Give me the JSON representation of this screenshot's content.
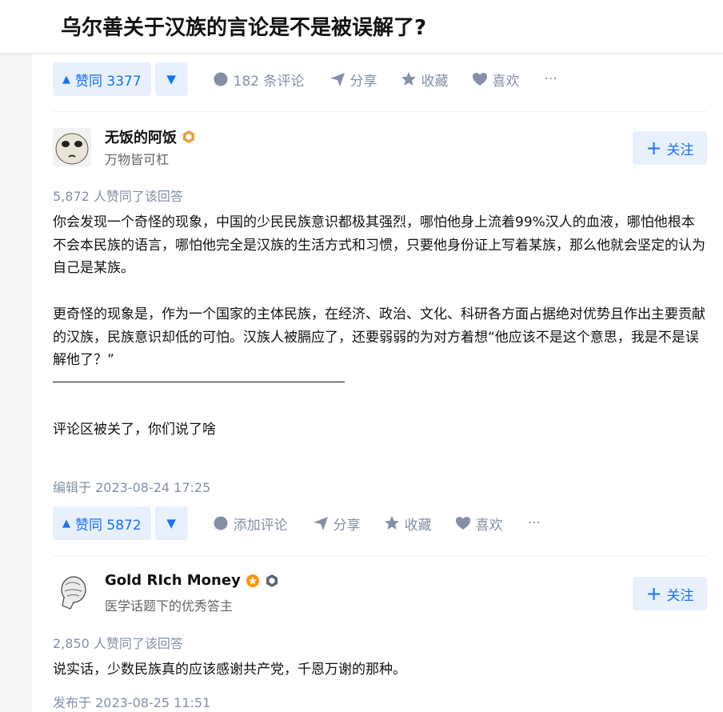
{
  "question": {
    "title": "乌尔善关于汉族的言论是不是被误解了?"
  },
  "top_actions": {
    "vote_up_label": "赞同 3377",
    "comments_label": "182 条评论",
    "share_label": "分享",
    "collect_label": "收藏",
    "like_label": "喜欢",
    "more_label": "···"
  },
  "answers": [
    {
      "author_name": "无饭的阿饭",
      "author_bio": "万物皆可杠",
      "follow_label": "关注",
      "votes_text": "5,872 人赞同了该回答",
      "paragraphs": [
        "你会发现一个奇怪的现象，中国的少民民族意识都极其强烈，哪怕他身上流着99%汉人的血液，哪怕他根本不会本民族的语言，哪怕他完全是汉族的生活方式和习惯，只要他身份证上写着某族，那么他就会坚定的认为自己是某族。",
        "更奇怪的现象是，作为一个国家的主体民族，在经济、政治、文化、科研各方面占据绝对优势且作出主要贡献的汉族，民族意识却低的可怕。汉族人被膈应了，还要弱弱的为对方着想“他应该不是这个意思，我是不是误解他了？”",
        "评论区被关了，你们说了啥"
      ],
      "time_text": "编辑于 2023-08-24 17:25",
      "actions": {
        "vote_up_label": "赞同 5872",
        "comments_label": "添加评论",
        "share_label": "分享",
        "collect_label": "收藏",
        "like_label": "喜欢",
        "more_label": "···"
      }
    },
    {
      "author_name": "Gold RIch Money",
      "author_bio": "医学话题下的优秀答主",
      "follow_label": "关注",
      "votes_text": "2,850 人赞同了该回答",
      "paragraphs": [
        "说实话，少数民族真的应该感谢共产党，千恩万谢的那种。"
      ],
      "time_text": "发布于 2023-08-25 11:51"
    }
  ],
  "colors": {
    "accent": "#1772f6",
    "accent_bg": "#e8f0fc",
    "muted": "#8590a6",
    "badge_gold": "#e6a23c",
    "badge_orange": "#ff9607"
  }
}
